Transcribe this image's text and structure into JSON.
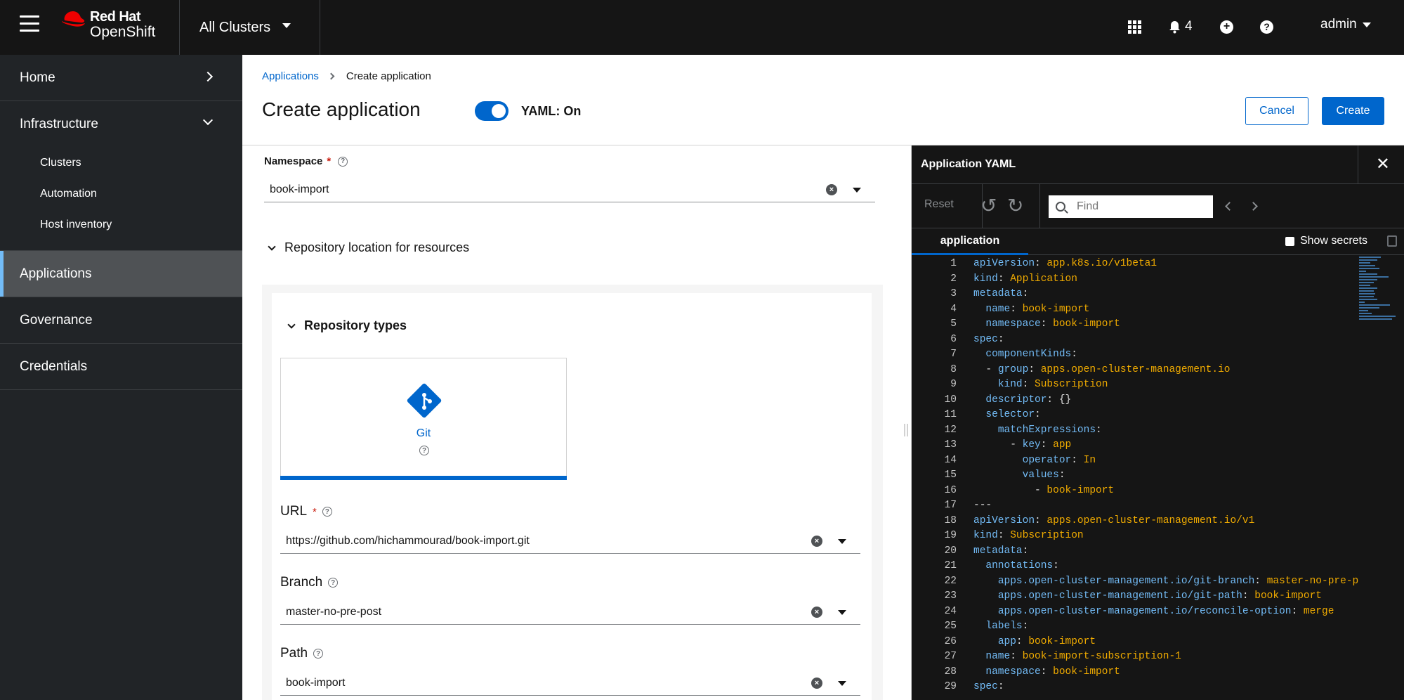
{
  "masthead": {
    "menu_icon": "hamburger-icon",
    "brand_line1": "Red Hat",
    "brand_line2": "OpenShift",
    "cluster_selector": "All Clusters",
    "notifications_count": "4",
    "user": "admin"
  },
  "sidebar": {
    "home": "Home",
    "infrastructure": "Infrastructure",
    "infra_items": [
      "Clusters",
      "Automation",
      "Host inventory"
    ],
    "applications": "Applications",
    "governance": "Governance",
    "credentials": "Credentials"
  },
  "header": {
    "breadcrumb_root": "Applications",
    "breadcrumb_current": "Create application",
    "title": "Create application",
    "yaml_toggle_label": "YAML: On",
    "cancel": "Cancel",
    "create": "Create"
  },
  "form": {
    "namespace_label": "Namespace",
    "namespace_value": "book-import",
    "repo_location_label": "Repository location for resources",
    "repo_types_label": "Repository types",
    "tile_git": "Git",
    "url_label": "URL",
    "url_value": "https://github.com/hichammourad/book-import.git",
    "branch_label": "Branch",
    "branch_value": "master-no-pre-post",
    "path_label": "Path",
    "path_value": "book-import"
  },
  "yaml_panel": {
    "title": "Application YAML",
    "reset": "Reset",
    "find_placeholder": "Find",
    "tab": "application",
    "show_secrets": "Show secrets",
    "lines": [
      {
        "n": "1",
        "i": "",
        "k": "apiVersion",
        "v": "app.k8s.io/v1beta1"
      },
      {
        "n": "2",
        "i": "",
        "k": "kind",
        "v": "Application"
      },
      {
        "n": "3",
        "i": "",
        "k": "metadata",
        "v": ""
      },
      {
        "n": "4",
        "i": "  ",
        "k": "name",
        "v": "book-import"
      },
      {
        "n": "5",
        "i": "  ",
        "k": "namespace",
        "v": "book-import"
      },
      {
        "n": "6",
        "i": "",
        "k": "spec",
        "v": ""
      },
      {
        "n": "7",
        "i": "  ",
        "k": "componentKinds",
        "v": ""
      },
      {
        "n": "8",
        "i": "  - ",
        "k": "group",
        "v": "apps.open-cluster-management.io"
      },
      {
        "n": "9",
        "i": "    ",
        "k": "kind",
        "v": "Subscription"
      },
      {
        "n": "10",
        "i": "  ",
        "k": "descriptor",
        "v": "{}"
      },
      {
        "n": "11",
        "i": "  ",
        "k": "selector",
        "v": ""
      },
      {
        "n": "12",
        "i": "    ",
        "k": "matchExpressions",
        "v": ""
      },
      {
        "n": "13",
        "i": "      - ",
        "k": "key",
        "v": "app"
      },
      {
        "n": "14",
        "i": "        ",
        "k": "operator",
        "v": "In"
      },
      {
        "n": "15",
        "i": "        ",
        "k": "values",
        "v": ""
      },
      {
        "n": "16",
        "i": "          - ",
        "k": "",
        "v": "book-import"
      },
      {
        "n": "17",
        "i": "",
        "k": "",
        "v": "---"
      },
      {
        "n": "18",
        "i": "",
        "k": "apiVersion",
        "v": "apps.open-cluster-management.io/v1"
      },
      {
        "n": "19",
        "i": "",
        "k": "kind",
        "v": "Subscription"
      },
      {
        "n": "20",
        "i": "",
        "k": "metadata",
        "v": ""
      },
      {
        "n": "21",
        "i": "  ",
        "k": "annotations",
        "v": ""
      },
      {
        "n": "22",
        "i": "    ",
        "k": "apps.open-cluster-management.io/git-branch",
        "v": "master-no-pre-p"
      },
      {
        "n": "23",
        "i": "    ",
        "k": "apps.open-cluster-management.io/git-path",
        "v": "book-import"
      },
      {
        "n": "24",
        "i": "    ",
        "k": "apps.open-cluster-management.io/reconcile-option",
        "v": "merge"
      },
      {
        "n": "25",
        "i": "  ",
        "k": "labels",
        "v": ""
      },
      {
        "n": "26",
        "i": "    ",
        "k": "app",
        "v": "book-import"
      },
      {
        "n": "27",
        "i": "  ",
        "k": "name",
        "v": "book-import-subscription-1"
      },
      {
        "n": "28",
        "i": "  ",
        "k": "namespace",
        "v": "book-import"
      },
      {
        "n": "29",
        "i": "",
        "k": "spec",
        "v": ""
      }
    ]
  },
  "colors": {
    "accent": "#0066cc",
    "masthead_bg": "#151515",
    "sidebar_bg": "#212427",
    "yaml_key": "#73bcf7",
    "yaml_value": "#f0ab00"
  }
}
